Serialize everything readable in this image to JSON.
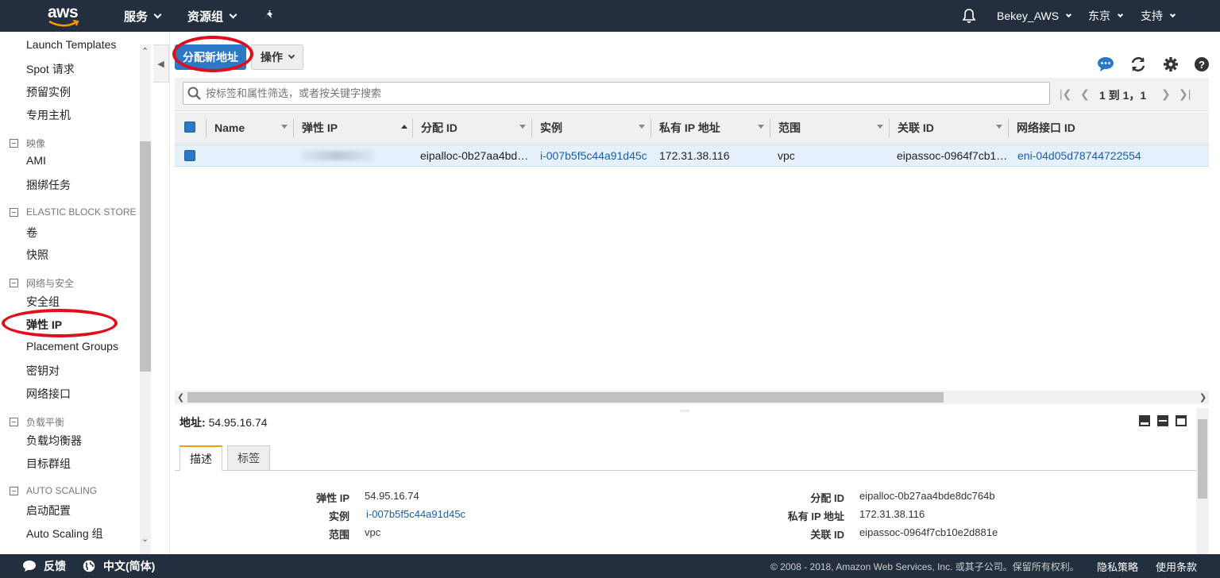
{
  "topnav": {
    "logo_text": "aws",
    "services": "服务",
    "resource_groups": "资源组",
    "account": "Bekey_AWS",
    "region": "东京",
    "support": "支持"
  },
  "sidebar": {
    "items_top": [
      "Launch Templates",
      "Spot 请求",
      "预留实例",
      "专用主机"
    ],
    "section_images": "映像",
    "images_items": [
      "AMI",
      "捆绑任务"
    ],
    "section_ebs": "ELASTIC BLOCK STORE",
    "ebs_items": [
      "卷",
      "快照"
    ],
    "section_network": "网络与安全",
    "network_items": [
      "安全组",
      "弹性 IP",
      "Placement Groups",
      "密钥对",
      "网络接口"
    ],
    "section_lb": "负载平衡",
    "lb_items": [
      "负载均衡器",
      "目标群组"
    ],
    "section_as": "AUTO SCALING",
    "as_items": [
      "启动配置",
      "Auto Scaling 组"
    ]
  },
  "toolbar": {
    "allocate_label": "分配新地址",
    "actions_label": "操作"
  },
  "filter": {
    "placeholder": "按标签和属性筛选，或者按关键字搜索",
    "page_range": "1 到 1，1"
  },
  "table": {
    "columns": [
      "Name",
      "弹性 IP",
      "分配 ID",
      "实例",
      "私有 IP 地址",
      "范围",
      "关联 ID",
      "网络接口 ID"
    ],
    "rows": [
      {
        "name": "",
        "elastic_ip": "",
        "allocation_id": "eipalloc-0b27aa4bd…",
        "instance": "i-007b5f5c44a91d45c",
        "private_ip": "172.31.38.116",
        "scope": "vpc",
        "association_id": "eipassoc-0964f7cb1…",
        "eni": "eni-04d05d78744722554"
      }
    ]
  },
  "details": {
    "title_label": "地址:",
    "title_value": "54.95.16.74",
    "tabs": [
      "描述",
      "标签"
    ],
    "left": [
      {
        "label": "弹性 IP",
        "value": "54.95.16.74"
      },
      {
        "label": "实例",
        "value": "i-007b5f5c44a91d45c"
      },
      {
        "label": "范围",
        "value": "vpc"
      }
    ],
    "right": [
      {
        "label": "分配 ID",
        "value": "eipalloc-0b27aa4bde8dc764b"
      },
      {
        "label": "私有 IP 地址",
        "value": "172.31.38.116"
      },
      {
        "label": "关联 ID",
        "value": "eipassoc-0964f7cb10e2d881e"
      }
    ]
  },
  "footer": {
    "feedback": "反馈",
    "language": "中文(简体)",
    "copyright": "© 2008 - 2018, Amazon Web Services, Inc. 或其子公司。保留所有权利。",
    "privacy": "隐私策略",
    "terms": "使用条款"
  },
  "colors": {
    "nav_bg": "#232f3e",
    "primary": "#2a78c6",
    "link": "#1a5ea8",
    "annotation_red": "#e10d1a",
    "selected_row": "#e5f0fb"
  },
  "icons": [
    "bell-icon",
    "pin-icon",
    "chat-icon",
    "refresh-icon",
    "gear-icon",
    "help-icon",
    "search-icon",
    "globe-icon",
    "speech-bubble-icon"
  ]
}
